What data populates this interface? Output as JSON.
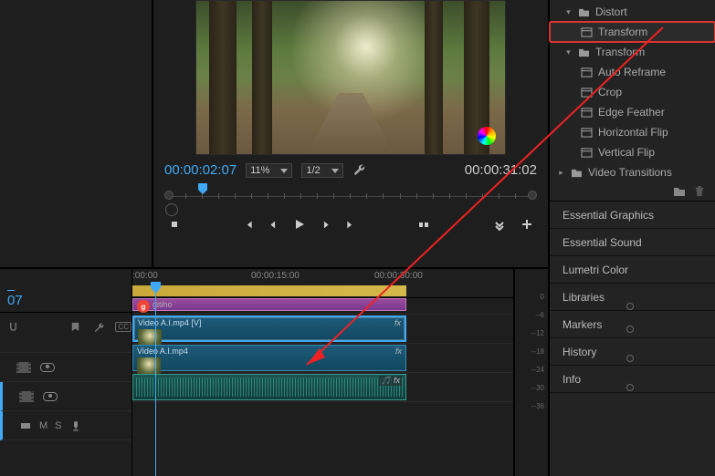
{
  "program": {
    "current_tc": "00:00:02:07",
    "total_tc": "00:00:31:02",
    "zoom": "11%",
    "resolution": "1/2"
  },
  "timeline": {
    "playhead_tc": "07",
    "ruler": {
      "t0": ":00:00",
      "t1": "00:00:15:00",
      "t2": "00:00:30:00"
    },
    "clips": {
      "graphic_label": "gitiho",
      "v2_label": "Video A.I.mp4 [V]",
      "v1_label": "Video A.I.mp4",
      "fx": "fx"
    },
    "audio_controls": {
      "mute": "M",
      "solo": "S"
    }
  },
  "meter": {
    "labels": [
      "0",
      "--6",
      "--12",
      "--18",
      "--24",
      "--30",
      "--36"
    ]
  },
  "effects": {
    "distort": "Distort",
    "transform_effect": "Transform",
    "transform_folder": "Transform",
    "items": {
      "auto_reframe": "Auto Reframe",
      "crop": "Crop",
      "edge_feather": "Edge Feather",
      "horizontal_flip": "Horizontal Flip",
      "vertical_flip": "Vertical Flip"
    },
    "video_transitions": "Video Transitions"
  },
  "panels": {
    "essential_graphics": "Essential Graphics",
    "essential_sound": "Essential Sound",
    "lumetri_color": "Lumetri Color",
    "libraries": "Libraries",
    "markers": "Markers",
    "history": "History",
    "info": "Info"
  }
}
